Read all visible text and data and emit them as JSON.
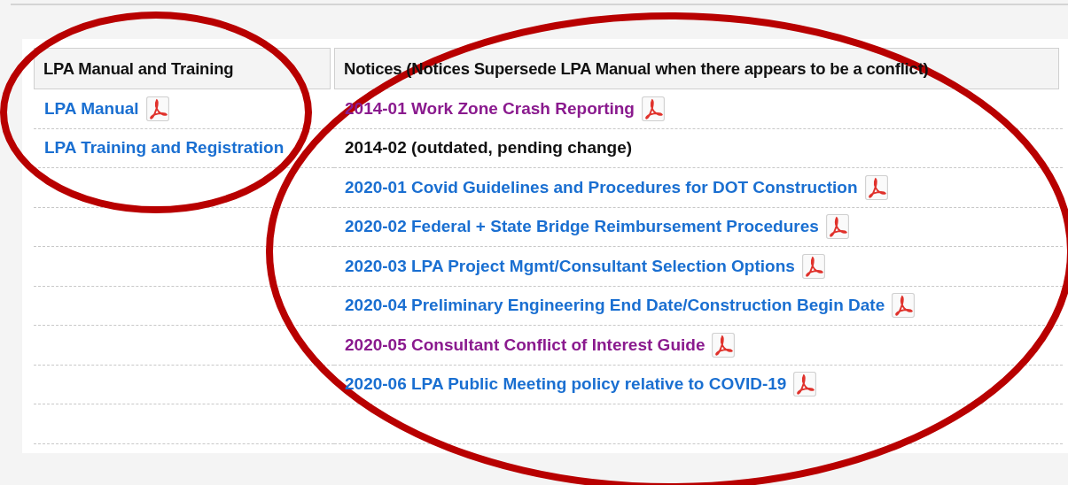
{
  "table": {
    "columns": [
      "LPA Manual and Training",
      "Notices (Notices Supersede LPA Manual when there appears to be a conflict)"
    ],
    "rows": [
      {
        "manual": {
          "text": "LPA Manual",
          "kind": "link",
          "visited": false,
          "pdf": true
        },
        "notice": {
          "text": "2014-01 Work Zone Crash Reporting",
          "kind": "link",
          "visited": true,
          "pdf": true
        }
      },
      {
        "manual": {
          "text": "LPA Training and Registration",
          "kind": "link",
          "visited": false,
          "pdf": false
        },
        "notice": {
          "text": "2014-02 (outdated, pending change)",
          "kind": "text",
          "pdf": false
        }
      },
      {
        "notice": {
          "text": "2020-01 Covid Guidelines and Procedures for DOT Construction",
          "kind": "link",
          "visited": false,
          "pdf": true
        }
      },
      {
        "notice": {
          "text": "2020-02 Federal + State Bridge Reimbursement Procedures",
          "kind": "link",
          "visited": false,
          "pdf": true
        }
      },
      {
        "notice": {
          "text": "2020-03 LPA Project Mgmt/Consultant Selection Options",
          "kind": "link",
          "visited": false,
          "pdf": true
        }
      },
      {
        "notice": {
          "text": "2020-04 Preliminary Engineering End Date/Construction Begin Date",
          "kind": "link",
          "visited": false,
          "pdf": true
        }
      },
      {
        "notice": {
          "text": "2020-05 Consultant Conflict of Interest Guide",
          "kind": "link",
          "visited": true,
          "pdf": true
        }
      },
      {
        "notice": {
          "text": "2020-06 LPA Public Meeting policy relative to COVID-19",
          "kind": "link",
          "visited": false,
          "pdf": true
        }
      },
      {}
    ]
  }
}
